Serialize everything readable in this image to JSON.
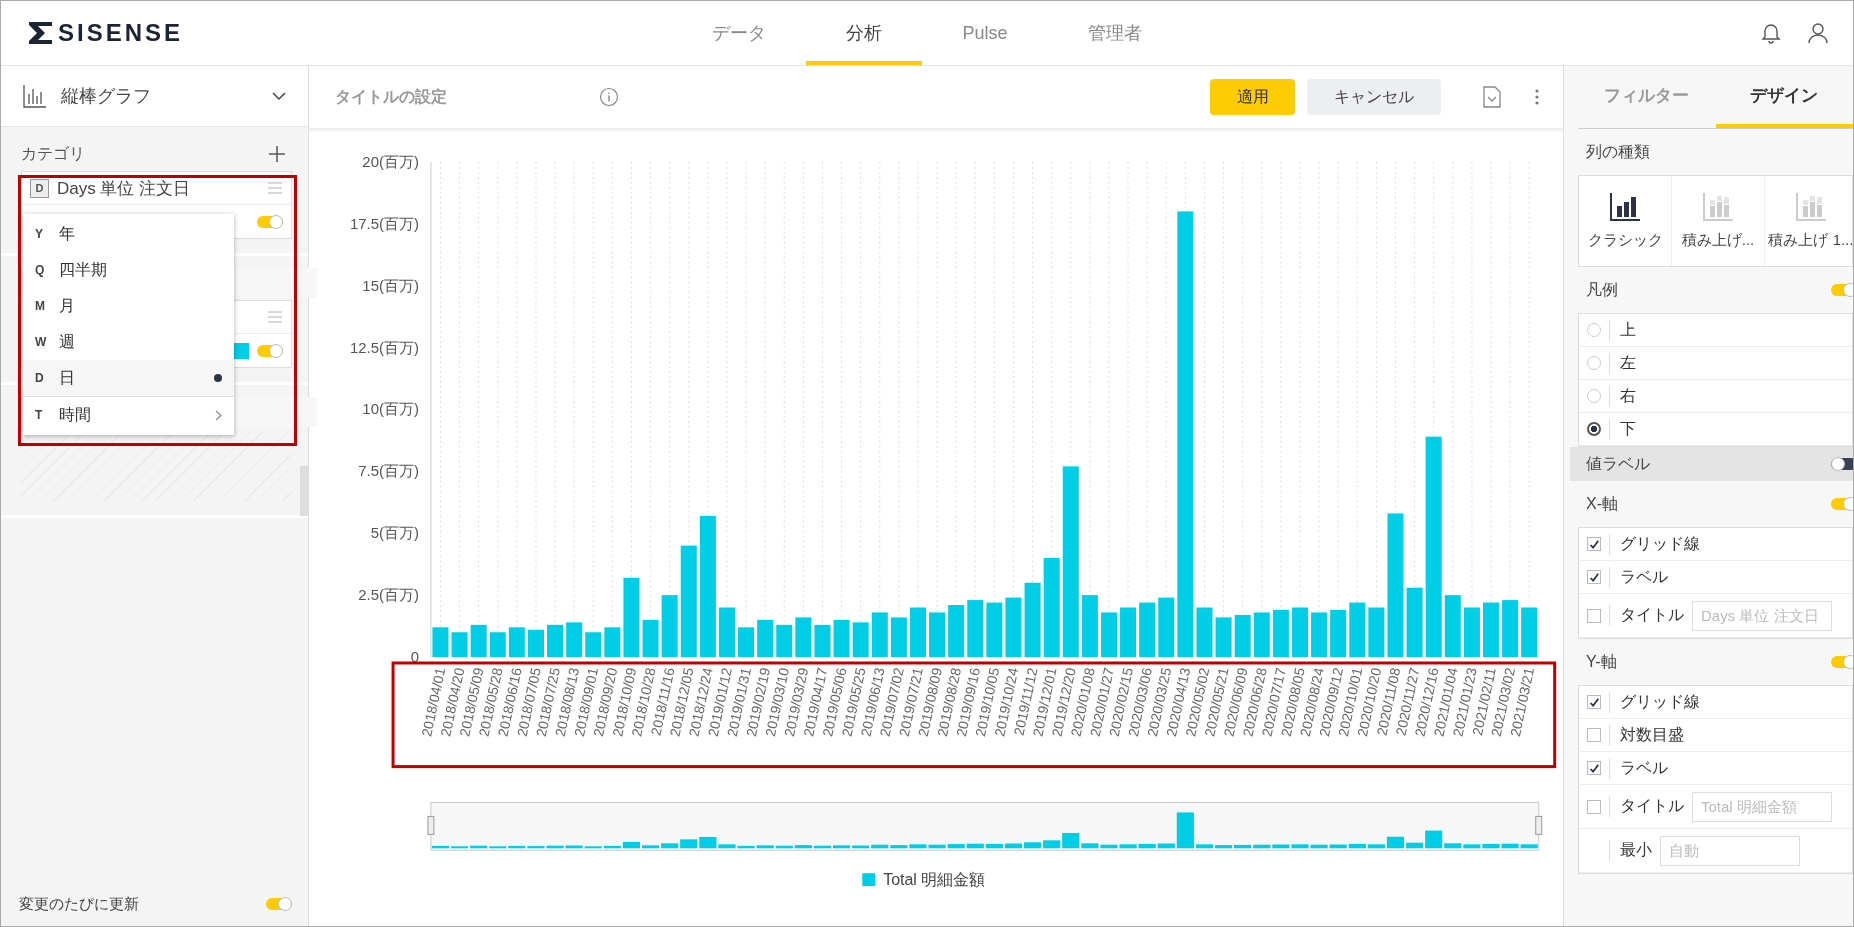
{
  "header": {
    "logo": "SISENSE",
    "nav": [
      {
        "label": "データ",
        "selected": false
      },
      {
        "label": "分析",
        "selected": true
      },
      {
        "label": "Pulse",
        "selected": false
      },
      {
        "label": "管理者",
        "selected": false
      }
    ]
  },
  "left_panel": {
    "chart_type": "縦棒グラフ",
    "category": {
      "title": "カテゴリ",
      "field": {
        "badge": "D",
        "label": "Days 単位 注文日"
      },
      "on": true
    },
    "value": {
      "color": "#00cee6",
      "on": true
    },
    "menu": [
      {
        "key": "Y",
        "label": "年",
        "selected": false,
        "kind": "option"
      },
      {
        "key": "Q",
        "label": "四半期",
        "selected": false,
        "kind": "option"
      },
      {
        "key": "M",
        "label": "月",
        "selected": false,
        "kind": "option"
      },
      {
        "key": "W",
        "label": "週",
        "selected": false,
        "kind": "option"
      },
      {
        "key": "D",
        "label": "日",
        "selected": true,
        "kind": "option"
      },
      {
        "key": "T",
        "label": "時間",
        "selected": false,
        "kind": "submenu"
      }
    ],
    "auto_update": {
      "label": "変更のたびに更新",
      "on": true
    }
  },
  "toolbar": {
    "title_placeholder": "タイトルの設定",
    "apply": "適用",
    "cancel": "キャンセル"
  },
  "chart_data": {
    "type": "bar",
    "categories": [
      "2018/04/01",
      "2018/04/20",
      "2018/05/09",
      "2018/05/28",
      "2018/06/16",
      "2018/07/05",
      "2018/07/25",
      "2018/08/13",
      "2018/09/01",
      "2018/09/20",
      "2018/10/09",
      "2018/10/28",
      "2018/11/16",
      "2018/12/05",
      "2018/12/24",
      "2019/01/12",
      "2019/01/31",
      "2019/02/19",
      "2019/03/10",
      "2019/03/29",
      "2019/04/17",
      "2019/05/06",
      "2019/05/25",
      "2019/06/13",
      "2019/07/02",
      "2019/07/21",
      "2019/08/09",
      "2019/08/28",
      "2019/09/16",
      "2019/10/05",
      "2019/10/24",
      "2019/11/12",
      "2019/12/01",
      "2019/12/20",
      "2020/01/08",
      "2020/01/27",
      "2020/02/15",
      "2020/03/06",
      "2020/03/25",
      "2020/04/13",
      "2020/05/02",
      "2020/05/21",
      "2020/06/09",
      "2020/06/28",
      "2020/07/17",
      "2020/08/05",
      "2020/08/24",
      "2020/09/12",
      "2020/10/01",
      "2020/10/20",
      "2020/11/08",
      "2020/11/27",
      "2020/12/16",
      "2021/01/04",
      "2021/01/23",
      "2021/02/11",
      "2021/03/02",
      "2021/03/21"
    ],
    "series": [
      {
        "name": "Total 明細金額",
        "color": "#00cee6",
        "values": [
          1.2,
          1.0,
          1.3,
          1.0,
          1.2,
          1.1,
          1.3,
          1.4,
          1.0,
          1.2,
          3.2,
          1.5,
          2.5,
          4.5,
          5.7,
          2.0,
          1.2,
          1.5,
          1.3,
          1.6,
          1.3,
          1.5,
          1.4,
          1.8,
          1.6,
          2.0,
          1.8,
          2.1,
          2.3,
          2.2,
          2.4,
          3.0,
          4.0,
          7.7,
          2.5,
          1.8,
          2.0,
          2.2,
          2.4,
          18.0,
          2.0,
          1.6,
          1.7,
          1.8,
          1.9,
          2.0,
          1.8,
          1.9,
          2.2,
          2.0,
          5.8,
          2.8,
          8.9,
          2.5,
          2.0,
          2.2,
          2.3,
          2.0
        ]
      }
    ],
    "ylim": [
      0,
      20
    ],
    "yticks": [
      {
        "value": 0,
        "label": "0"
      },
      {
        "value": 2.5,
        "label": "2.5(百万)"
      },
      {
        "value": 5,
        "label": "5(百万)"
      },
      {
        "value": 7.5,
        "label": "7.5(百万)"
      },
      {
        "value": 10,
        "label": "10(百万)"
      },
      {
        "value": 12.5,
        "label": "12.5(百万)"
      },
      {
        "value": 15,
        "label": "15(百万)"
      },
      {
        "value": 17.5,
        "label": "17.5(百万)"
      },
      {
        "value": 20,
        "label": "20(百万)"
      }
    ]
  },
  "right_panel": {
    "tabs": [
      {
        "label": "フィルター",
        "selected": false
      },
      {
        "label": "デザイン",
        "selected": true
      }
    ],
    "column_types": {
      "title": "列の種類",
      "items": [
        {
          "label": "クラシック",
          "selected": true
        },
        {
          "label": "積み上げ...",
          "selected": false
        },
        {
          "label": "積み上げ 1...",
          "selected": false
        }
      ]
    },
    "legend": {
      "title": "凡例",
      "on": true,
      "options": [
        {
          "label": "上",
          "selected": false
        },
        {
          "label": "左",
          "selected": false
        },
        {
          "label": "右",
          "selected": false
        },
        {
          "label": "下",
          "selected": true
        }
      ]
    },
    "value_labels": {
      "title": "値ラベル",
      "on": false
    },
    "axes": [
      {
        "title": "X-軸",
        "on": true,
        "options": [
          {
            "kind": "checkbox",
            "label": "グリッド線",
            "checked": true
          },
          {
            "kind": "checkbox",
            "label": "ラベル",
            "checked": true
          },
          {
            "kind": "field_checkbox",
            "label": "タイトル",
            "checked": false,
            "placeholder": "Days 単位 注文日"
          }
        ]
      },
      {
        "title": "Y-軸",
        "on": true,
        "options": [
          {
            "kind": "checkbox",
            "label": "グリッド線",
            "checked": true
          },
          {
            "kind": "checkbox",
            "label": "対数目盛",
            "checked": false
          },
          {
            "kind": "checkbox",
            "label": "ラベル",
            "checked": true
          },
          {
            "kind": "field_checkbox",
            "label": "タイトル",
            "checked": false,
            "placeholder": "Total 明細金額"
          },
          {
            "kind": "field",
            "label": "最小",
            "placeholder": "自動"
          }
        ]
      }
    ]
  }
}
